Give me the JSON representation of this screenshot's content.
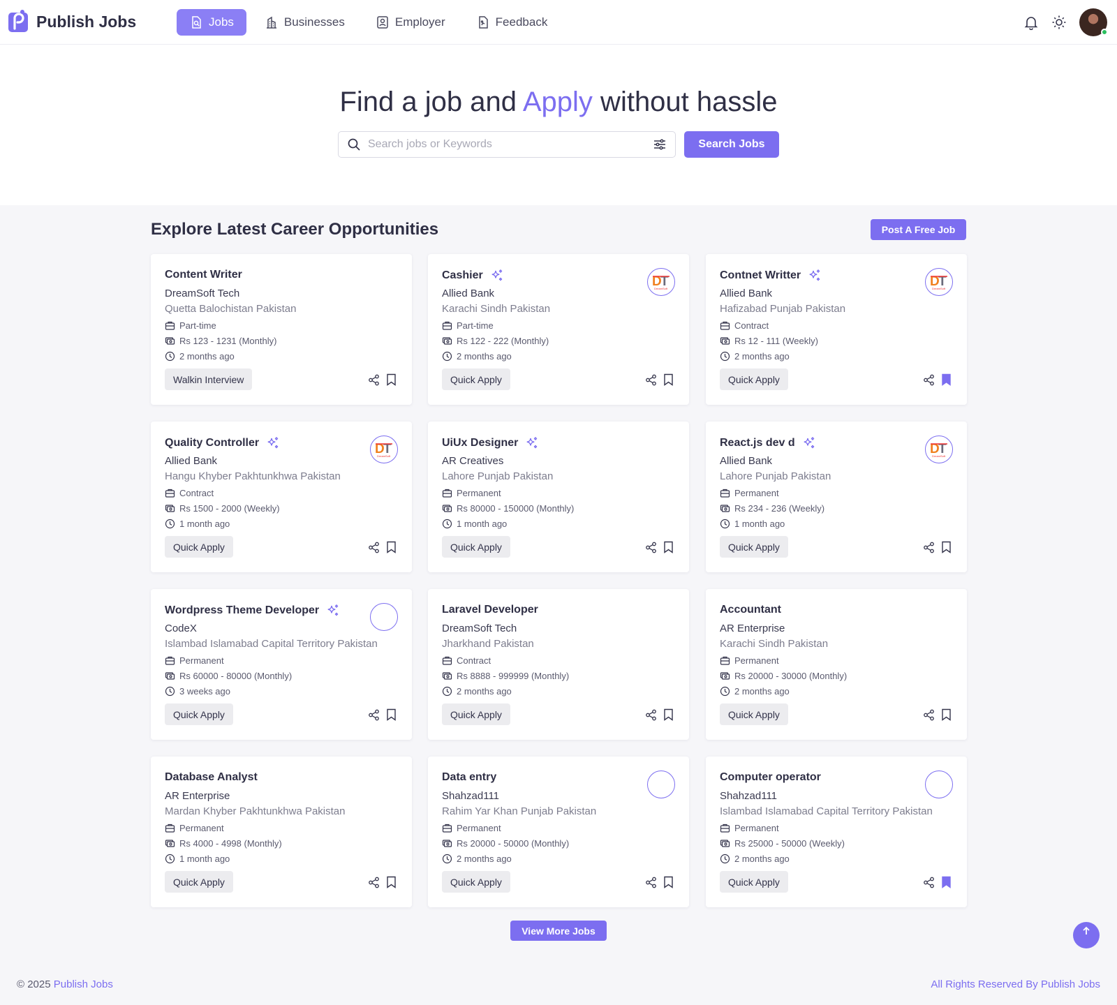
{
  "brand": {
    "name": "Publish Jobs"
  },
  "nav": {
    "items": [
      {
        "label": "Jobs",
        "icon": "document-search-icon",
        "active": true
      },
      {
        "label": "Businesses",
        "icon": "building-icon",
        "active": false
      },
      {
        "label": "Employer",
        "icon": "id-badge-icon",
        "active": false
      },
      {
        "label": "Feedback",
        "icon": "feedback-icon",
        "active": false
      }
    ]
  },
  "hero": {
    "title_pre": "Find a job and ",
    "title_accent": "Apply",
    "title_post": " without hassle",
    "search_placeholder": "Search jobs or Keywords",
    "search_button": "Search Jobs"
  },
  "section": {
    "title": "Explore Latest Career Opportunities",
    "post_button": "Post A Free Job"
  },
  "jobs": [
    {
      "title": "Content Writer",
      "company": "DreamSoft Tech",
      "location": "Quetta  Balochistan  Pakistan",
      "type": "Part-time",
      "salary": "Rs 123 - 1231 (Monthly)",
      "posted": "2 months ago",
      "action": "Walkin Interview",
      "featured": false,
      "logo": "none",
      "bookmarked": false
    },
    {
      "title": "Cashier",
      "company": "Allied Bank",
      "location": "Karachi  Sindh  Pakistan",
      "type": "Part-time",
      "salary": "Rs 122 - 222 (Monthly)",
      "posted": "2 months ago",
      "action": "Quick Apply",
      "featured": true,
      "logo": "dt",
      "bookmarked": false
    },
    {
      "title": "Contnet Writter",
      "company": "Allied Bank",
      "location": "Hafizabad  Punjab  Pakistan",
      "type": "Contract",
      "salary": "Rs 12 - 111 (Weekly)",
      "posted": "2 months ago",
      "action": "Quick Apply",
      "featured": true,
      "logo": "dt",
      "bookmarked": true
    },
    {
      "title": "Quality Controller",
      "company": "Allied Bank",
      "location": "Hangu  Khyber Pakhtunkhwa  Pakistan",
      "type": "Contract",
      "salary": "Rs 1500 - 2000 (Weekly)",
      "posted": "1 month ago",
      "action": "Quick Apply",
      "featured": true,
      "logo": "dt",
      "bookmarked": false
    },
    {
      "title": "UiUx Designer",
      "company": "AR Creatives",
      "location": "Lahore  Punjab  Pakistan",
      "type": "Permanent",
      "salary": "Rs 80000 - 150000 (Monthly)",
      "posted": "1 month ago",
      "action": "Quick Apply",
      "featured": true,
      "logo": "none",
      "bookmarked": false
    },
    {
      "title": "React.js dev d",
      "company": "Allied Bank",
      "location": "Lahore  Punjab  Pakistan",
      "type": "Permanent",
      "salary": "Rs 234 - 236 (Weekly)",
      "posted": "1 month ago",
      "action": "Quick Apply",
      "featured": true,
      "logo": "dt",
      "bookmarked": false
    },
    {
      "title": "Wordpress Theme Developer",
      "company": "CodeX",
      "location": "Islambad  Islamabad Capital Territory  Pakistan",
      "type": "Permanent",
      "salary": "Rs 60000 - 80000 (Monthly)",
      "posted": "3 weeks ago",
      "action": "Quick Apply",
      "featured": true,
      "logo": "empty",
      "bookmarked": false
    },
    {
      "title": "Laravel Developer",
      "company": "DreamSoft Tech",
      "location": "  Jharkhand  Pakistan",
      "type": "Contract",
      "salary": "Rs 8888 - 999999 (Monthly)",
      "posted": "2 months ago",
      "action": "Quick Apply",
      "featured": false,
      "logo": "none",
      "bookmarked": false
    },
    {
      "title": "Accountant",
      "company": "AR Enterprise",
      "location": "Karachi  Sindh  Pakistan",
      "type": "Permanent",
      "salary": "Rs 20000 - 30000 (Monthly)",
      "posted": "2 months ago",
      "action": "Quick Apply",
      "featured": false,
      "logo": "none",
      "bookmarked": false
    },
    {
      "title": "Database Analyst",
      "company": "AR Enterprise",
      "location": "Mardan  Khyber Pakhtunkhwa  Pakistan",
      "type": "Permanent",
      "salary": "Rs 4000 - 4998 (Monthly)",
      "posted": "1 month ago",
      "action": "Quick Apply",
      "featured": false,
      "logo": "none",
      "bookmarked": false
    },
    {
      "title": "Data entry",
      "company": "Shahzad111",
      "location": "Rahim Yar Khan  Punjab  Pakistan",
      "type": "Permanent",
      "salary": "Rs 20000 - 50000 (Monthly)",
      "posted": "2 months ago",
      "action": "Quick Apply",
      "featured": false,
      "logo": "empty",
      "bookmarked": false
    },
    {
      "title": "Computer operator",
      "company": "Shahzad111",
      "location": "Islambad  Islamabad Capital Territory  Pakistan",
      "type": "Permanent",
      "salary": "Rs 25000 - 50000 (Weekly)",
      "posted": "2 months ago",
      "action": "Quick Apply",
      "featured": false,
      "logo": "empty",
      "bookmarked": true
    }
  ],
  "view_more": "View More Jobs",
  "footer": {
    "copyright": "© 2025 ",
    "brand_link": "Publish Jobs",
    "rights": "All Rights Reserved By Publish Jobs"
  },
  "colors": {
    "accent": "#7c6ef0",
    "nav_active": "#8b7ff5"
  },
  "icons": {
    "notification": "bell-icon",
    "theme": "sun-icon",
    "search": "search-icon",
    "filter": "sliders-icon",
    "share": "share-icon",
    "bookmark": "bookmark-icon",
    "job_type": "briefcase-icon",
    "salary": "money-icon",
    "posted": "clock-icon",
    "featured": "sparkle-icon",
    "scroll_top": "arrow-up-icon"
  }
}
